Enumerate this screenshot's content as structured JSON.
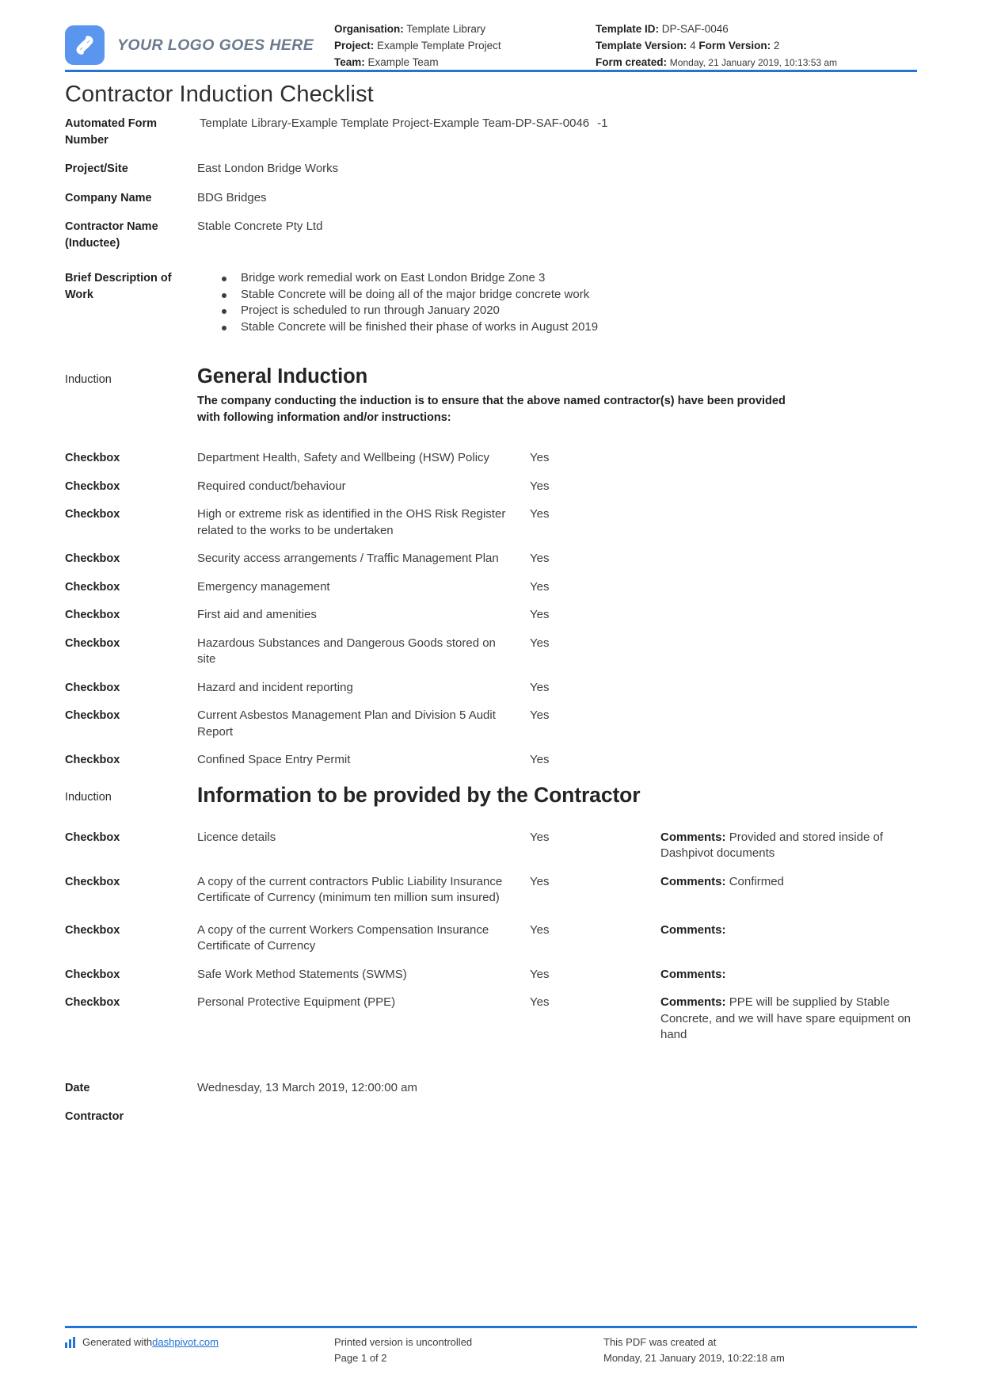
{
  "brand": {
    "accent": "#2075d6",
    "logo_blue": "#5b96ee",
    "logo_text": "YOUR LOGO GOES HERE"
  },
  "header": {
    "organisation_label": "Organisation:",
    "organisation_value": "Template Library",
    "project_label": "Project:",
    "project_value": "Example Template Project",
    "team_label": "Team:",
    "team_value": "Example Team",
    "template_id_label": "Template ID:",
    "template_id_value": "DP-SAF-0046",
    "template_version_label": "Template Version:",
    "template_version_value": "4",
    "form_version_label": "Form Version:",
    "form_version_value": "2",
    "form_created_label": "Form created:",
    "form_created_value": "Monday, 21 January 2019, 10:13:53 am"
  },
  "title": "Contractor Induction Checklist",
  "fields": {
    "automated_form_number_label": "Automated Form Number",
    "automated_form_number_value": "Template Library-Example Template Project-Example Team-DP-SAF-0046",
    "automated_form_number_suffix": "-1",
    "project_site_label": "Project/Site",
    "project_site_value": "East London Bridge Works",
    "company_name_label": "Company Name",
    "company_name_value": "BDG Bridges",
    "contractor_name_label": "Contractor Name (Inductee)",
    "contractor_name_value": "Stable Concrete Pty Ltd",
    "brief_description_label": "Brief Description of Work",
    "brief_description_bullets": [
      "Bridge work remedial work on East London Bridge Zone 3",
      "Stable Concrete will be doing all of the major bridge concrete work",
      "Project is scheduled to run through January 2020",
      "Stable Concrete will be finished their phase of works in August 2019"
    ]
  },
  "general_induction": {
    "row_label": "Induction",
    "heading": "General Induction",
    "subtext": "The company conducting the induction is to ensure that the above named contractor(s) have been provided with following information and/or instructions:",
    "checkbox_label": "Checkbox",
    "items": [
      {
        "description": "Department Health, Safety and Wellbeing (HSW) Policy",
        "answer": "Yes"
      },
      {
        "description": "Required conduct/behaviour",
        "answer": "Yes"
      },
      {
        "description": "High or extreme risk as identified in the OHS Risk Register related to the works to be undertaken",
        "answer": "Yes"
      },
      {
        "description": "Security access arrangements / Traffic Management Plan",
        "answer": "Yes"
      },
      {
        "description": "Emergency management",
        "answer": "Yes"
      },
      {
        "description": "First aid and amenities",
        "answer": "Yes"
      },
      {
        "description": "Hazardous Substances and Dangerous Goods stored on site",
        "answer": "Yes"
      },
      {
        "description": "Hazard and incident reporting",
        "answer": "Yes"
      },
      {
        "description": "Current Asbestos Management Plan and Division 5 Audit Report",
        "answer": "Yes"
      },
      {
        "description": "Confined Space Entry Permit",
        "answer": "Yes"
      }
    ]
  },
  "contractor_info": {
    "row_label": "Induction",
    "heading": "Information to be provided by the Contractor",
    "checkbox_label": "Checkbox",
    "comments_label": "Comments:",
    "items": [
      {
        "description": "Licence details",
        "answer": "Yes",
        "comment": "Provided and stored inside of Dashpivot documents"
      },
      {
        "description": "A copy of the current contractors Public Liability Insurance Certificate of Currency (minimum ten million sum insured)",
        "answer": "Yes",
        "comment": "Confirmed"
      },
      {
        "description": "A copy of the current Workers Compensation Insurance Certificate of Currency",
        "answer": "Yes",
        "comment": ""
      },
      {
        "description": "Safe Work Method Statements (SWMS)",
        "answer": "Yes",
        "comment": ""
      },
      {
        "description": "Personal Protective Equipment (PPE)",
        "answer": "Yes",
        "comment": "PPE will be supplied by Stable Concrete, and we will have spare equipment on hand"
      }
    ]
  },
  "signoff": {
    "date_label": "Date",
    "date_value": "Wednesday, 13 March 2019, 12:00:00 am",
    "contractor_label": "Contractor"
  },
  "footer": {
    "generated_prefix": "Generated with ",
    "generated_link": "dashpivot.com",
    "uncontrolled": "Printed version is uncontrolled",
    "page": "Page 1 of 2",
    "created_at": "This PDF was created at",
    "created_at_value": "Monday, 21 January 2019, 10:22:18 am"
  }
}
